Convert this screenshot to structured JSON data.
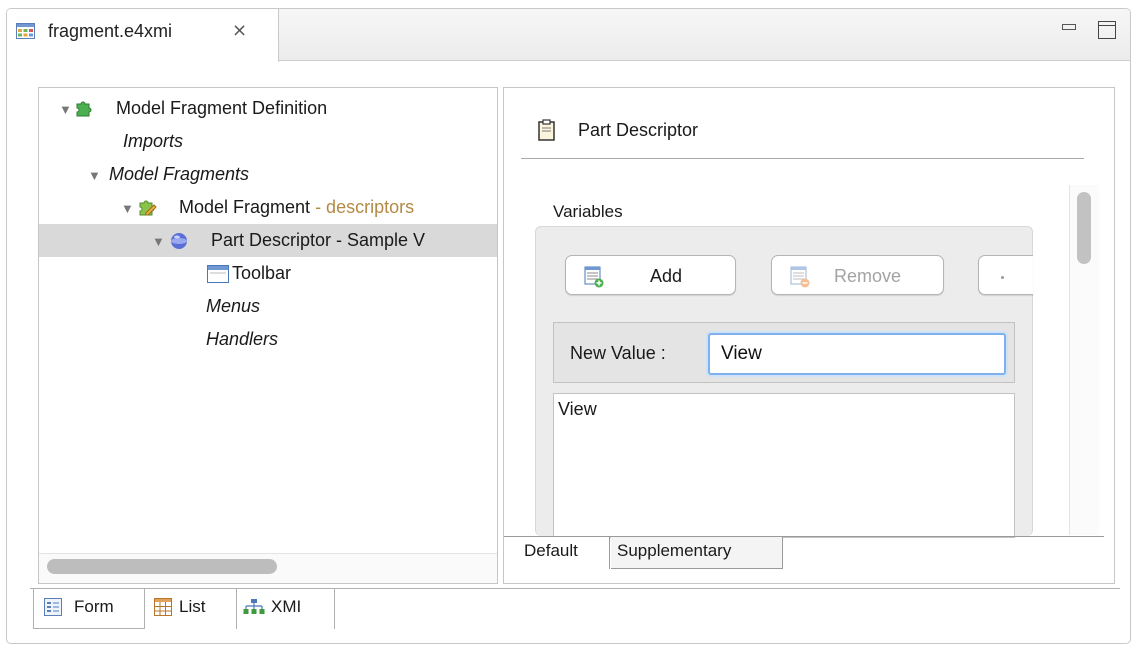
{
  "editor": {
    "tab_label": "fragment.e4xmi",
    "tab_close_glyph": "⨯"
  },
  "tree": {
    "items": [
      {
        "label": "Model Fragment Definition",
        "icon": "puzzle-green-icon",
        "italic": false,
        "expanded": true
      },
      {
        "label": "Imports",
        "italic": true
      },
      {
        "label": "Model Fragments",
        "italic": true,
        "expanded": true
      },
      {
        "label": "Model Fragment",
        "annotation": " - descriptors",
        "icon": "puzzle-edit-icon",
        "expanded": true
      },
      {
        "label": "Part Descriptor - Sample V",
        "icon": "sphere-icon",
        "expanded": true,
        "selected": true
      },
      {
        "label": "Toolbar",
        "icon": "toolbar-icon"
      },
      {
        "label": "Menus",
        "italic": true
      },
      {
        "label": "Handlers",
        "italic": true
      }
    ]
  },
  "details": {
    "header_title": "Part Descriptor",
    "variables_label": "Variables",
    "add_label": "Add",
    "remove_label": "Remove",
    "new_value_label": "New Value :",
    "new_value_input": "View",
    "values": [
      "View"
    ],
    "tabs": [
      {
        "label": "Default",
        "active": true
      },
      {
        "label": "Supplementary",
        "active": false
      }
    ]
  },
  "bottom_tabs": [
    {
      "label": "Form",
      "icon": "form-icon",
      "active": true
    },
    {
      "label": "List",
      "icon": "table-icon",
      "active": false
    },
    {
      "label": "XMI",
      "icon": "hierarchy-icon",
      "active": false
    }
  ],
  "colors": {
    "annotation": "#b38a45",
    "selection": "#d9d9d9",
    "focus_ring": "#7fb2ea"
  }
}
